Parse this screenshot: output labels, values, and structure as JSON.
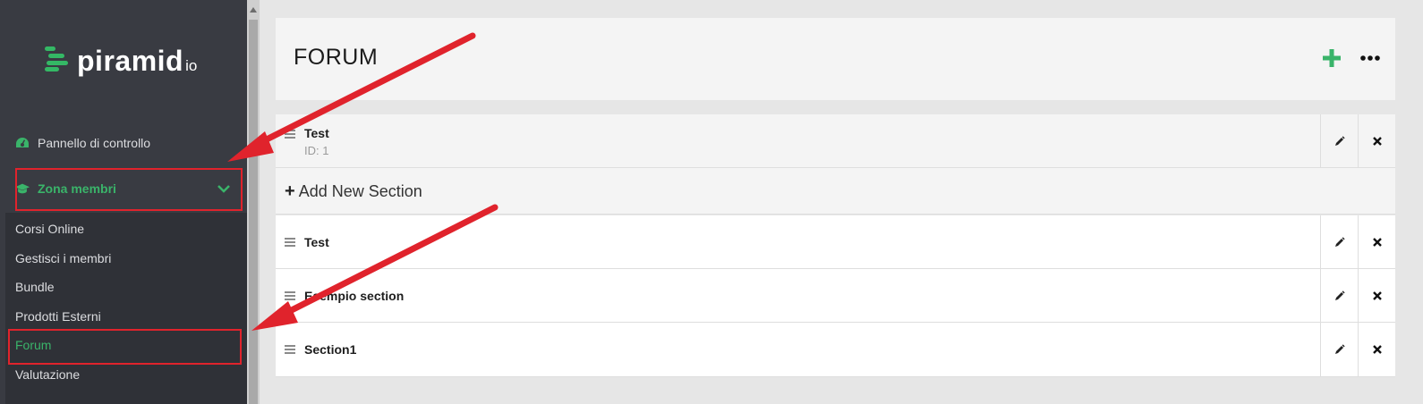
{
  "sidebar": {
    "logo": {
      "text": "piramid",
      "tld": "io"
    },
    "nav": [
      {
        "label": "Pannello di controllo",
        "icon": "dashboard-icon"
      },
      {
        "label": "Zona membri",
        "icon": "graduation-cap-icon",
        "expanded": true
      }
    ],
    "submenu": [
      {
        "label": "Corsi Online"
      },
      {
        "label": "Gestisci i membri"
      },
      {
        "label": "Bundle"
      },
      {
        "label": "Prodotti Esterni"
      },
      {
        "label": "Forum",
        "active": true
      },
      {
        "label": "Valutazione"
      }
    ]
  },
  "main": {
    "title": "FORUM",
    "category": {
      "name": "Test",
      "id_label": "ID: 1"
    },
    "add_section_label": "Add New Section",
    "sections": [
      {
        "name": "Test"
      },
      {
        "name": "Esempio section"
      },
      {
        "name": "Section1"
      }
    ]
  },
  "colors": {
    "accent_green": "#3ab46a",
    "sidebar_bg": "#393b42",
    "annotation_red": "#e0232c"
  }
}
